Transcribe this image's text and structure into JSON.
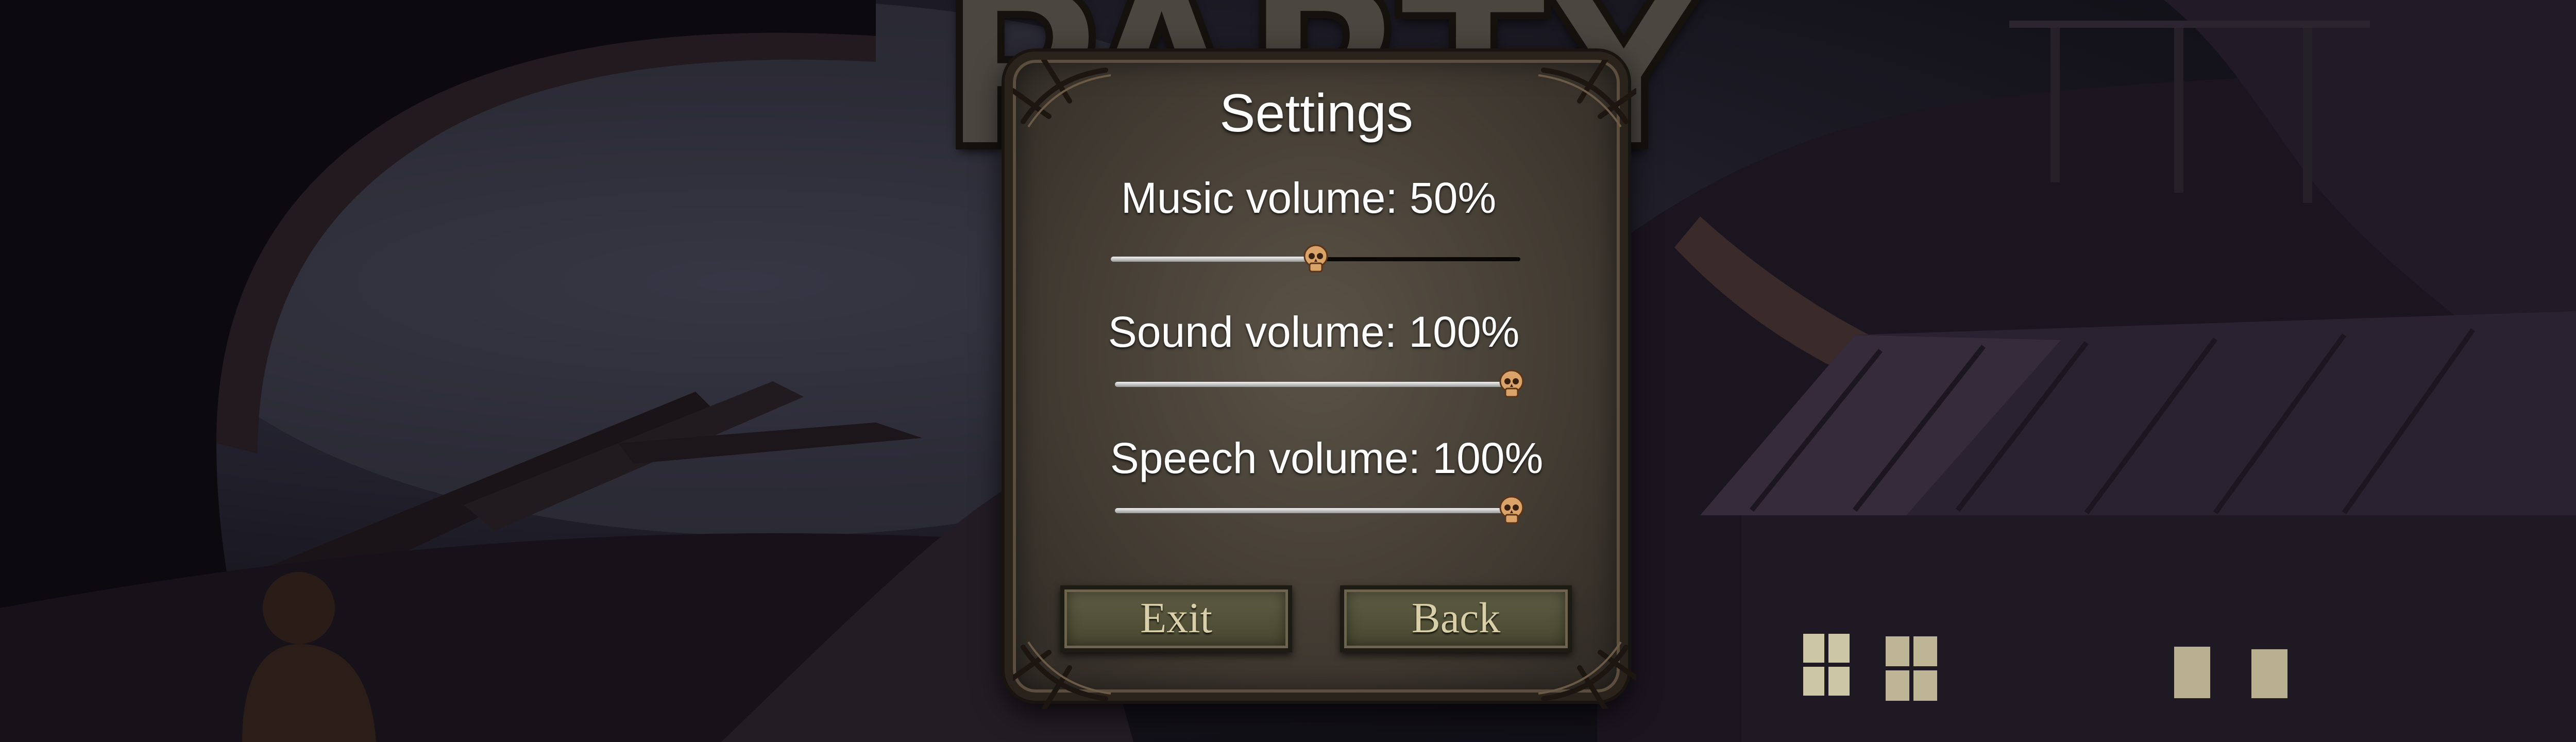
{
  "settings": {
    "title": "Settings",
    "music": {
      "label": "Music volume: 50%",
      "value": 0.5
    },
    "sound": {
      "label": "Sound volume: 100%",
      "value": 1.0
    },
    "speech": {
      "label": "Speech volume: 100%",
      "value": 1.0
    },
    "buttons": {
      "exit": "Exit",
      "back": "Back"
    }
  },
  "background": {
    "logo_text": "PARTY"
  },
  "colors": {
    "panel": "#443d34",
    "button": "#5a5a3f",
    "button_text": "#d8cfa8",
    "thumb": "#d9a36a"
  }
}
